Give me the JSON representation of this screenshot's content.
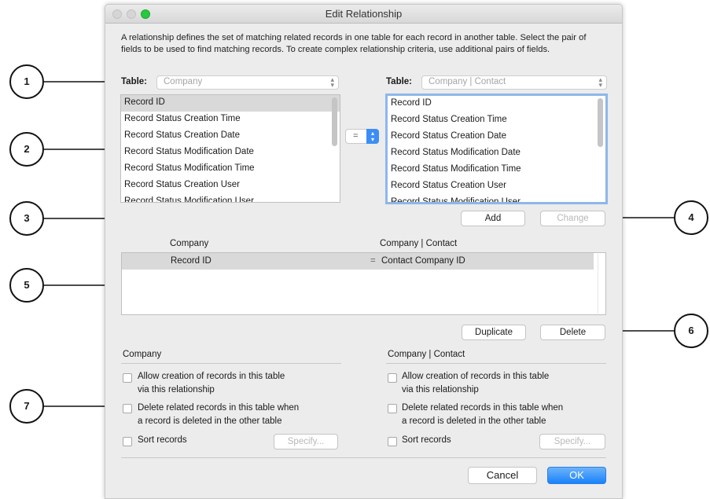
{
  "window": {
    "title": "Edit Relationship"
  },
  "description": "A relationship defines the set of matching related records in one table for each record in another table. Select the pair of fields to be used to find matching records. To create complex relationship criteria, use additional pairs of fields.",
  "left_table": {
    "label": "Table:",
    "value": "Company"
  },
  "right_table": {
    "label": "Table:",
    "value": "Company | Contact"
  },
  "left_fields": [
    "Record ID",
    "Record Status Creation Time",
    "Record Status Creation Date",
    "Record Status Modification Date",
    "Record Status Modification Time",
    "Record Status Creation User",
    "Record Status Modification User"
  ],
  "right_fields": [
    "Record ID",
    "Record Status Creation Time",
    "Record Status Creation Date",
    "Record Status Modification Date",
    "Record Status Modification Time",
    "Record Status Creation User",
    "Record Status Modification User"
  ],
  "operator": "=",
  "buttons": {
    "add": "Add",
    "change": "Change",
    "duplicate": "Duplicate",
    "delete": "Delete",
    "cancel": "Cancel",
    "ok": "OK"
  },
  "criteria": {
    "left_header": "Company",
    "right_header": "Company | Contact",
    "rows": [
      {
        "left": "Record ID",
        "op": "=",
        "right": "Contact Company ID"
      }
    ]
  },
  "left_options": {
    "header": "Company",
    "allow_line1": "Allow creation of records in this table",
    "allow_line2": "via this relationship",
    "delete_line1": "Delete related records in this table when",
    "delete_line2": "a record is deleted in the other table",
    "sort": "Sort records",
    "specify": "Specify..."
  },
  "right_options": {
    "header": "Company | Contact",
    "allow_line1": "Allow creation of records in this table",
    "allow_line2": "via this relationship",
    "delete_line1": "Delete related records in this table when",
    "delete_line2": "a record is deleted in the other table",
    "sort": "Sort records",
    "specify": "Specify..."
  },
  "callouts": [
    "1",
    "2",
    "3",
    "4",
    "5",
    "6",
    "7"
  ]
}
